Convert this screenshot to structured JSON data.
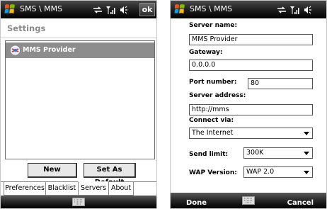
{
  "left": {
    "title": "SMS \\ MMS",
    "ok_label": "ok",
    "heading": "Settings",
    "list_items": [
      {
        "label": "MMS Provider",
        "icon": "mms-provider-icon"
      }
    ],
    "buttons": {
      "new": "New",
      "set_default": "Set As Default"
    },
    "tabs": [
      "Preferences",
      "Blacklist",
      "Servers",
      "About"
    ],
    "active_tab": "Servers"
  },
  "right": {
    "title": "SMS \\ MMS",
    "server_name": {
      "label": "Server name:",
      "value": "MMS Provider"
    },
    "gateway": {
      "label": "Gateway:",
      "value": "0.0.0.0"
    },
    "port": {
      "label": "Port number:",
      "value": "80"
    },
    "server_address": {
      "label": "Server address:",
      "value": "http://mms"
    },
    "connect_via": {
      "label": "Connect via:",
      "value": "The Internet"
    },
    "send_limit": {
      "label": "Send limit:",
      "value": "300K"
    },
    "wap_version": {
      "label": "WAP Version:",
      "value": "WAP 2.0"
    },
    "softkeys": {
      "left": "Done",
      "right": "Cancel"
    }
  },
  "icons": [
    "start-icon",
    "connectivity-icon",
    "signal-icon",
    "volume-icon",
    "keyboard-icon"
  ],
  "colors": {
    "titlebar": "#1c1c1c",
    "selection": "#8d8d8d"
  }
}
